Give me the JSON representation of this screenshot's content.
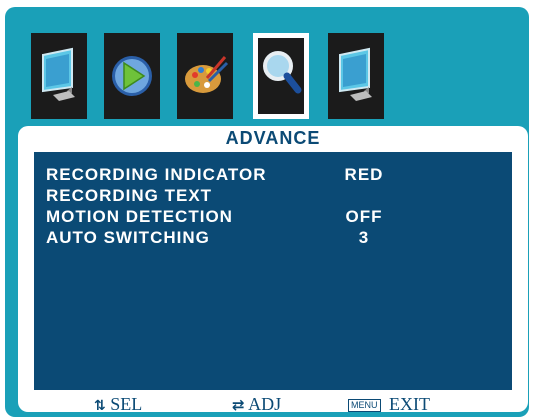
{
  "menu": {
    "tabs": [
      {
        "icon": "monitor-icon",
        "selected": false
      },
      {
        "icon": "play-icon",
        "selected": false
      },
      {
        "icon": "palette-icon",
        "selected": false
      },
      {
        "icon": "magnifier-icon",
        "selected": true
      },
      {
        "icon": "monitor-icon",
        "selected": false
      }
    ],
    "title": "ADVANCE",
    "items": [
      {
        "label": "RECORDING INDICATOR",
        "value": "RED"
      },
      {
        "label": "RECORDING TEXT",
        "value": ""
      },
      {
        "label": "MOTION DETECTION",
        "value": "OFF"
      },
      {
        "label": "AUTO SWITCHING",
        "value": "3"
      }
    ],
    "footer": {
      "sel_glyph": "⇅",
      "sel_label": "SEL",
      "adj_glyph": "⇄",
      "adj_label": "ADJ",
      "menu_key": "MENU",
      "exit_label": "EXIT"
    }
  },
  "colors": {
    "frame_bg": "#1aa0b8",
    "content_bg": "#0b4a75",
    "title_text": "#0b4a75"
  }
}
